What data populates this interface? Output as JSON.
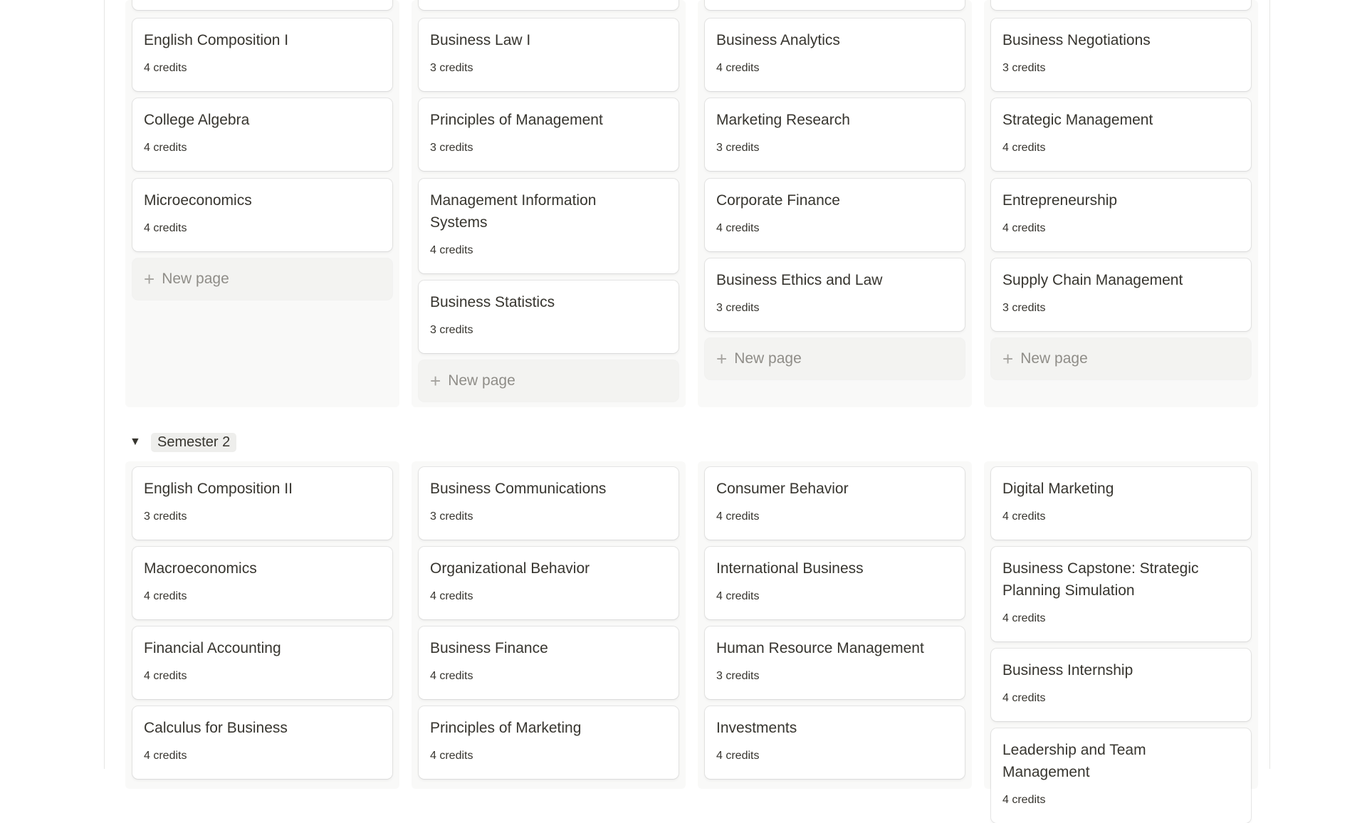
{
  "semester1": {
    "columns": [
      {
        "cards": [
          {
            "title": "English Composition I",
            "credits": "4 credits"
          },
          {
            "title": "College Algebra",
            "credits": "4 credits"
          },
          {
            "title": "Microeconomics",
            "credits": "4 credits"
          }
        ],
        "new_page": "New page"
      },
      {
        "cards": [
          {
            "title": "Business Law I",
            "credits": "3 credits"
          },
          {
            "title": "Principles of Management",
            "credits": "3 credits"
          },
          {
            "title": "Management Information Systems",
            "credits": "4 credits"
          },
          {
            "title": "Business Statistics",
            "credits": "3 credits"
          }
        ],
        "new_page": "New page"
      },
      {
        "cards": [
          {
            "title": "Business Analytics",
            "credits": "4 credits"
          },
          {
            "title": "Marketing Research",
            "credits": "3 credits"
          },
          {
            "title": "Corporate Finance",
            "credits": "4 credits"
          },
          {
            "title": "Business Ethics and Law",
            "credits": "3 credits"
          }
        ],
        "new_page": "New page"
      },
      {
        "cards": [
          {
            "title": "Business Negotiations",
            "credits": "3 credits"
          },
          {
            "title": "Strategic Management",
            "credits": "4 credits"
          },
          {
            "title": "Entrepreneurship",
            "credits": "4 credits"
          },
          {
            "title": "Supply Chain Management",
            "credits": "3 credits"
          }
        ],
        "new_page": "New page"
      }
    ]
  },
  "semester2": {
    "label": "Semester 2",
    "toggle": "▼",
    "columns": [
      {
        "cards": [
          {
            "title": "English Composition II",
            "credits": "3 credits"
          },
          {
            "title": "Macroeconomics",
            "credits": "4 credits"
          },
          {
            "title": "Financial Accounting",
            "credits": "4 credits"
          },
          {
            "title": "Calculus for Business",
            "credits": "4 credits"
          }
        ]
      },
      {
        "cards": [
          {
            "title": "Business Communications",
            "credits": "3 credits"
          },
          {
            "title": "Organizational Behavior",
            "credits": "4 credits"
          },
          {
            "title": "Business Finance",
            "credits": "4 credits"
          },
          {
            "title": "Principles of Marketing",
            "credits": "4 credits"
          }
        ]
      },
      {
        "cards": [
          {
            "title": "Consumer Behavior",
            "credits": "4 credits"
          },
          {
            "title": "International Business",
            "credits": "4 credits"
          },
          {
            "title": "Human Resource Management",
            "credits": "3 credits"
          },
          {
            "title": "Investments",
            "credits": "4 credits"
          }
        ]
      },
      {
        "cards": [
          {
            "title": "Digital Marketing",
            "credits": "4 credits"
          },
          {
            "title": "Business Capstone: Strategic Planning Simulation",
            "credits": "4 credits"
          },
          {
            "title": "Business Internship",
            "credits": "4 credits"
          },
          {
            "title": "Leadership and Team Management",
            "credits": "4 credits"
          }
        ]
      }
    ]
  }
}
